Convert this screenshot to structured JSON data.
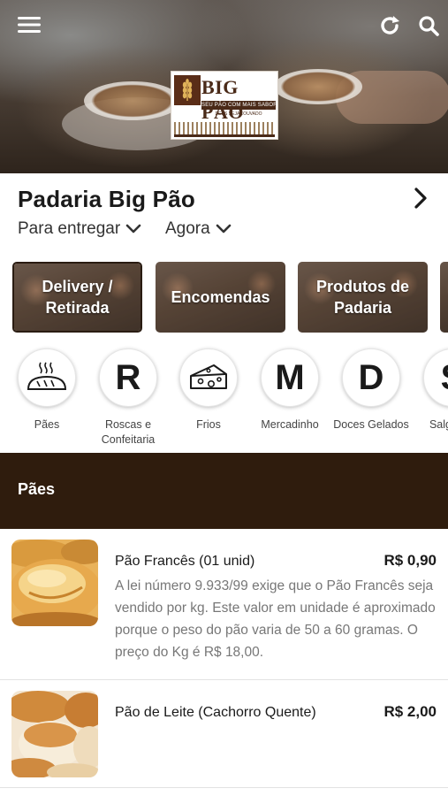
{
  "header": {
    "icons": {
      "menu": "menu-icon",
      "refresh": "refresh-icon",
      "search": "search-icon"
    },
    "logo": {
      "brand": "BIG PÃO",
      "tagline": "SEU PÃO COM MAIS SABOR",
      "blessing": "DEUS SEJA LOUVADO"
    }
  },
  "store": {
    "name": "Padaria Big Pão",
    "delivery_mode": "Para entregar",
    "time": "Agora"
  },
  "banners": [
    {
      "label": "Delivery / Retirada"
    },
    {
      "label": "Encomendas"
    },
    {
      "label": "Produtos de Padaria"
    }
  ],
  "categories": [
    {
      "name": "Pães",
      "icon": "bread-icon"
    },
    {
      "name": "Roscas e Confeitaria",
      "letter": "R"
    },
    {
      "name": "Frios",
      "icon": "cheese-icon"
    },
    {
      "name": "Mercadinho",
      "letter": "M"
    },
    {
      "name": "Doces Gelados",
      "letter": "D"
    },
    {
      "name": "Salgados",
      "letter": "S"
    }
  ],
  "section": {
    "title": "Pães"
  },
  "products": [
    {
      "name": "Pão Francês (01 unid)",
      "price": "R$ 0,90",
      "description": "A lei número 9.933/99 exige que o Pão Francês seja vendido por kg. Este valor em unidade é aproximado porque o peso do pão varia de 50 a 60 gramas. O preço do Kg é R$ 18,00."
    },
    {
      "name": "Pão de Leite (Cachorro Quente)",
      "price": "R$ 2,00",
      "description": ""
    }
  ],
  "colors": {
    "section_bg": "#2f1c0d",
    "brand_brown": "#4a2a18"
  }
}
